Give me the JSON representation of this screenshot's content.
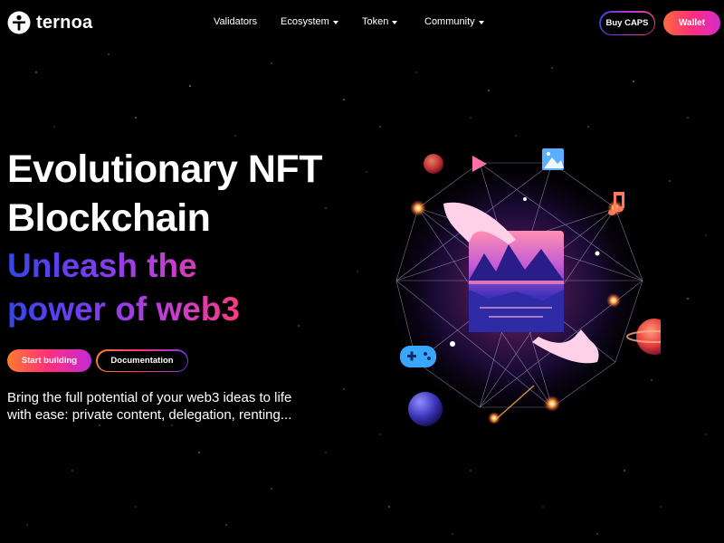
{
  "brand": {
    "name": "ternoa",
    "logo_icon": "ternoa-logo-icon"
  },
  "nav": [
    {
      "label": "Validators",
      "has_dropdown": false
    },
    {
      "label": "Ecosystem",
      "has_dropdown": true
    },
    {
      "label": "Token",
      "has_dropdown": true
    },
    {
      "label": "Community",
      "has_dropdown": true
    }
  ],
  "header_actions": {
    "buy_caps_label": "Buy CAPS",
    "wallet_label": "Wallet"
  },
  "hero": {
    "title_line1": "Evolutionary NFT",
    "title_line2": "Blockchain",
    "subtitle_line1": "Unleash the",
    "subtitle_line2": "power of web3",
    "start_button_label": "Start building",
    "docs_button_label": "Documentation",
    "description_line1": "Bring the full potential of your web3 ideas to life",
    "description_line2": "with ease: private content, delegation, renting..."
  },
  "illustration": {
    "icons": [
      "play-icon",
      "image-icon",
      "music-note-icon",
      "gamepad-icon",
      "planet-icon",
      "hand-icon",
      "nft-artwork-card"
    ]
  },
  "colors": {
    "background": "#000000",
    "gradient_start": "#ff6a3d",
    "gradient_mid": "#ff2e7e",
    "gradient_end": "#c02bd6",
    "subtitle_blue": "#3346e8"
  }
}
